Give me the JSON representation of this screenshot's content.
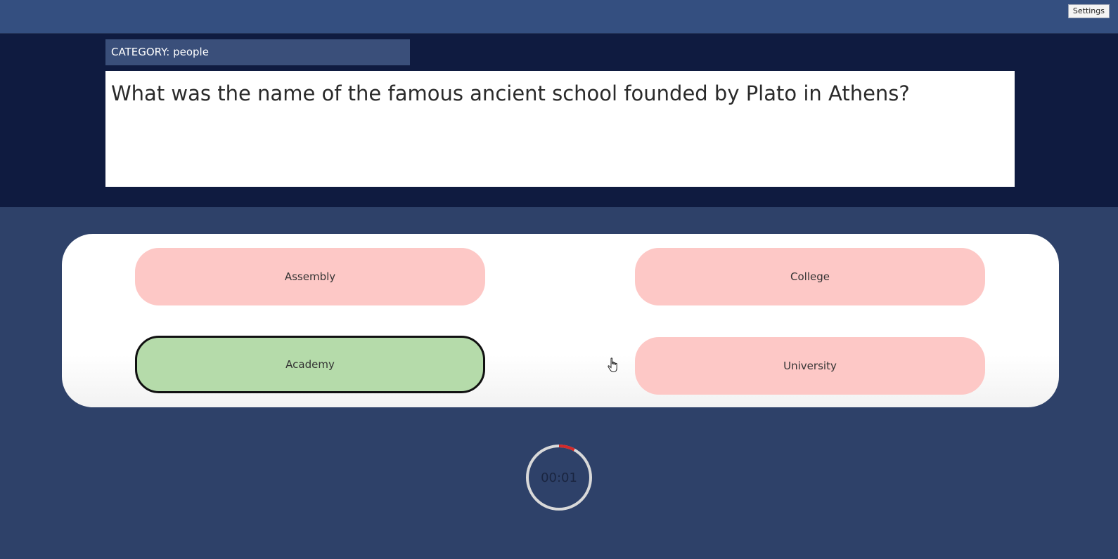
{
  "header": {
    "settings_label": "Settings"
  },
  "question": {
    "category": "CATEGORY: people",
    "text": "What was the name of the famous ancient school founded by Plato in Athens?"
  },
  "answers": [
    {
      "label": "Assembly",
      "state": "incorrect"
    },
    {
      "label": "College",
      "state": "incorrect"
    },
    {
      "label": "Academy",
      "state": "correct-selected"
    },
    {
      "label": "University",
      "state": "incorrect"
    }
  ],
  "timer": {
    "display": "00:01",
    "elapsed_fraction": 0.08
  },
  "colors": {
    "topbar": "#344f80",
    "question_band": "#0f1b40",
    "background": "#2e4169",
    "answer_incorrect": "#fdc8c6",
    "answer_correct": "#b5dbaa",
    "timer_arc": "#d42a2a"
  }
}
